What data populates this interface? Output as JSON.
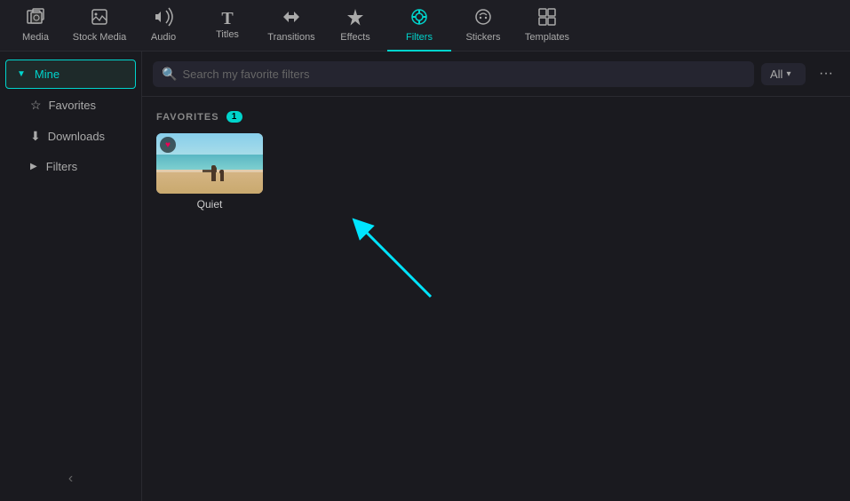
{
  "topNav": {
    "items": [
      {
        "id": "media",
        "label": "Media",
        "icon": "🖼",
        "active": false
      },
      {
        "id": "stock-media",
        "label": "Stock Media",
        "icon": "📷",
        "active": false
      },
      {
        "id": "audio",
        "label": "Audio",
        "icon": "🎵",
        "active": false
      },
      {
        "id": "titles",
        "label": "Titles",
        "icon": "T",
        "active": false
      },
      {
        "id": "transitions",
        "label": "Transitions",
        "icon": "↔",
        "active": false
      },
      {
        "id": "effects",
        "label": "Effects",
        "icon": "✨",
        "active": false
      },
      {
        "id": "filters",
        "label": "Filters",
        "icon": "◉",
        "active": true
      },
      {
        "id": "stickers",
        "label": "Stickers",
        "icon": "◎",
        "active": false
      },
      {
        "id": "templates",
        "label": "Templates",
        "icon": "⊞",
        "active": false
      }
    ]
  },
  "sidebar": {
    "sectionLabel": "Mine",
    "items": [
      {
        "id": "favorites",
        "label": "Favorites",
        "icon": "☆",
        "active": false
      },
      {
        "id": "downloads",
        "label": "Downloads",
        "icon": "⬇",
        "active": false
      },
      {
        "id": "filters",
        "label": "Filters",
        "icon": "▶",
        "active": false
      }
    ],
    "collapseIcon": "‹"
  },
  "searchBar": {
    "placeholder": "Search my favorite filters",
    "filterLabel": "All",
    "moreIcon": "···"
  },
  "content": {
    "favoritesSection": {
      "title": "FAVORITES",
      "count": "1"
    },
    "filterCard": {
      "name": "Quiet"
    }
  }
}
